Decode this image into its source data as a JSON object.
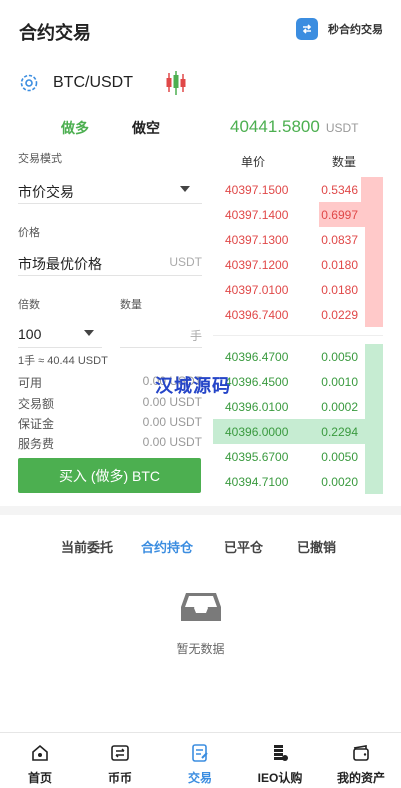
{
  "header": {
    "title": "合约交易",
    "sec_contract_label": "秒合约交易"
  },
  "pair": {
    "name": "BTC/USDT"
  },
  "side_tabs": {
    "long": "做多",
    "short": "做空"
  },
  "last_price": {
    "value": "40441.5800",
    "unit": "USDT"
  },
  "form": {
    "trade_mode_label": "交易模式",
    "trade_mode_value": "市价交易",
    "price_label": "价格",
    "price_value": "市场最优价格",
    "price_unit": "USDT",
    "multiple_label": "倍数",
    "quantity_label": "数量",
    "multiple_value": "100",
    "quantity_unit": "手",
    "lot_note": "1手 ≈ 40.44 USDT"
  },
  "info": [
    {
      "key": "可用",
      "value": "0.00 USDT"
    },
    {
      "key": "交易额",
      "value": "0.00 USDT"
    },
    {
      "key": "保证金",
      "value": "0.00 USDT"
    },
    {
      "key": "服务费",
      "value": "0.00 USDT"
    }
  ],
  "buy_button": "买入 (做多) BTC",
  "orderbook": {
    "price_header": "单价",
    "qty_header": "数量",
    "asks": [
      {
        "price": "40397.1500",
        "qty": "0.5346",
        "depth": 0.13
      },
      {
        "price": "40397.1400",
        "qty": "0.6997",
        "depth": 0.27
      },
      {
        "price": "40397.1300",
        "qty": "0.0837",
        "depth": 0.05
      },
      {
        "price": "40397.1200",
        "qty": "0.0180",
        "depth": 0.05
      },
      {
        "price": "40397.0100",
        "qty": "0.0180",
        "depth": 0.05
      },
      {
        "price": "40396.7400",
        "qty": "0.0229",
        "depth": 0.05
      }
    ],
    "bids": [
      {
        "price": "40396.4700",
        "qty": "0.0050",
        "depth": 0.05
      },
      {
        "price": "40396.4500",
        "qty": "0.0010",
        "depth": 0.05
      },
      {
        "price": "40396.0100",
        "qty": "0.0002",
        "depth": 0.05
      },
      {
        "price": "40396.0000",
        "qty": "0.2294",
        "depth": 1.0
      },
      {
        "price": "40395.6700",
        "qty": "0.0050",
        "depth": 0.05
      },
      {
        "price": "40394.7100",
        "qty": "0.0020",
        "depth": 0.05
      }
    ]
  },
  "watermark": "汉城源码",
  "order_tabs": [
    {
      "label": "当前委托",
      "active": false
    },
    {
      "label": "合约持仓",
      "active": true
    },
    {
      "label": "已平仓",
      "active": false
    },
    {
      "label": "已撤销",
      "active": false
    }
  ],
  "empty_text": "暂无数据",
  "nav": [
    {
      "label": "首页",
      "icon": "home-icon",
      "active": false
    },
    {
      "label": "币币",
      "icon": "exchange-icon",
      "active": false
    },
    {
      "label": "交易",
      "icon": "trade-icon",
      "active": true
    },
    {
      "label": "IEO认购",
      "icon": "coins-icon",
      "active": false
    },
    {
      "label": "我的资产",
      "icon": "wallet-icon",
      "active": false
    }
  ],
  "colors": {
    "accent": "#3b8de0",
    "buy": "#4caf50",
    "sell": "#e04848",
    "ask_bar": "#ffc9c9",
    "bid_bar": "#c6ecd2"
  }
}
